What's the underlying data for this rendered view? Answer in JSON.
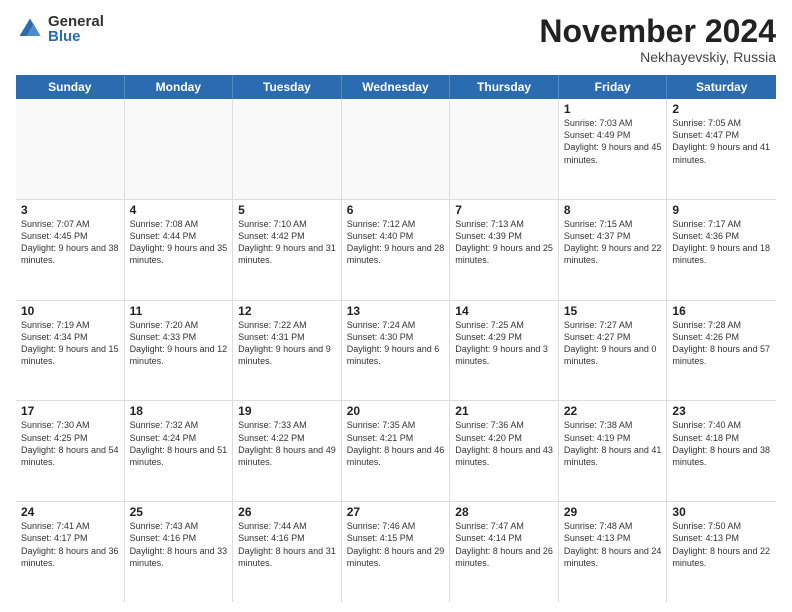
{
  "logo": {
    "general": "General",
    "blue": "Blue"
  },
  "title": "November 2024",
  "location": "Nekhayevskiy, Russia",
  "days": [
    "Sunday",
    "Monday",
    "Tuesday",
    "Wednesday",
    "Thursday",
    "Friday",
    "Saturday"
  ],
  "weeks": [
    [
      {
        "day": "",
        "text": "",
        "empty": true
      },
      {
        "day": "",
        "text": "",
        "empty": true
      },
      {
        "day": "",
        "text": "",
        "empty": true
      },
      {
        "day": "",
        "text": "",
        "empty": true
      },
      {
        "day": "",
        "text": "",
        "empty": true
      },
      {
        "day": "1",
        "text": "Sunrise: 7:03 AM\nSunset: 4:49 PM\nDaylight: 9 hours and 45 minutes.",
        "empty": false
      },
      {
        "day": "2",
        "text": "Sunrise: 7:05 AM\nSunset: 4:47 PM\nDaylight: 9 hours and 41 minutes.",
        "empty": false
      }
    ],
    [
      {
        "day": "3",
        "text": "Sunrise: 7:07 AM\nSunset: 4:45 PM\nDaylight: 9 hours and 38 minutes.",
        "empty": false
      },
      {
        "day": "4",
        "text": "Sunrise: 7:08 AM\nSunset: 4:44 PM\nDaylight: 9 hours and 35 minutes.",
        "empty": false
      },
      {
        "day": "5",
        "text": "Sunrise: 7:10 AM\nSunset: 4:42 PM\nDaylight: 9 hours and 31 minutes.",
        "empty": false
      },
      {
        "day": "6",
        "text": "Sunrise: 7:12 AM\nSunset: 4:40 PM\nDaylight: 9 hours and 28 minutes.",
        "empty": false
      },
      {
        "day": "7",
        "text": "Sunrise: 7:13 AM\nSunset: 4:39 PM\nDaylight: 9 hours and 25 minutes.",
        "empty": false
      },
      {
        "day": "8",
        "text": "Sunrise: 7:15 AM\nSunset: 4:37 PM\nDaylight: 9 hours and 22 minutes.",
        "empty": false
      },
      {
        "day": "9",
        "text": "Sunrise: 7:17 AM\nSunset: 4:36 PM\nDaylight: 9 hours and 18 minutes.",
        "empty": false
      }
    ],
    [
      {
        "day": "10",
        "text": "Sunrise: 7:19 AM\nSunset: 4:34 PM\nDaylight: 9 hours and 15 minutes.",
        "empty": false
      },
      {
        "day": "11",
        "text": "Sunrise: 7:20 AM\nSunset: 4:33 PM\nDaylight: 9 hours and 12 minutes.",
        "empty": false
      },
      {
        "day": "12",
        "text": "Sunrise: 7:22 AM\nSunset: 4:31 PM\nDaylight: 9 hours and 9 minutes.",
        "empty": false
      },
      {
        "day": "13",
        "text": "Sunrise: 7:24 AM\nSunset: 4:30 PM\nDaylight: 9 hours and 6 minutes.",
        "empty": false
      },
      {
        "day": "14",
        "text": "Sunrise: 7:25 AM\nSunset: 4:29 PM\nDaylight: 9 hours and 3 minutes.",
        "empty": false
      },
      {
        "day": "15",
        "text": "Sunrise: 7:27 AM\nSunset: 4:27 PM\nDaylight: 9 hours and 0 minutes.",
        "empty": false
      },
      {
        "day": "16",
        "text": "Sunrise: 7:28 AM\nSunset: 4:26 PM\nDaylight: 8 hours and 57 minutes.",
        "empty": false
      }
    ],
    [
      {
        "day": "17",
        "text": "Sunrise: 7:30 AM\nSunset: 4:25 PM\nDaylight: 8 hours and 54 minutes.",
        "empty": false
      },
      {
        "day": "18",
        "text": "Sunrise: 7:32 AM\nSunset: 4:24 PM\nDaylight: 8 hours and 51 minutes.",
        "empty": false
      },
      {
        "day": "19",
        "text": "Sunrise: 7:33 AM\nSunset: 4:22 PM\nDaylight: 8 hours and 49 minutes.",
        "empty": false
      },
      {
        "day": "20",
        "text": "Sunrise: 7:35 AM\nSunset: 4:21 PM\nDaylight: 8 hours and 46 minutes.",
        "empty": false
      },
      {
        "day": "21",
        "text": "Sunrise: 7:36 AM\nSunset: 4:20 PM\nDaylight: 8 hours and 43 minutes.",
        "empty": false
      },
      {
        "day": "22",
        "text": "Sunrise: 7:38 AM\nSunset: 4:19 PM\nDaylight: 8 hours and 41 minutes.",
        "empty": false
      },
      {
        "day": "23",
        "text": "Sunrise: 7:40 AM\nSunset: 4:18 PM\nDaylight: 8 hours and 38 minutes.",
        "empty": false
      }
    ],
    [
      {
        "day": "24",
        "text": "Sunrise: 7:41 AM\nSunset: 4:17 PM\nDaylight: 8 hours and 36 minutes.",
        "empty": false
      },
      {
        "day": "25",
        "text": "Sunrise: 7:43 AM\nSunset: 4:16 PM\nDaylight: 8 hours and 33 minutes.",
        "empty": false
      },
      {
        "day": "26",
        "text": "Sunrise: 7:44 AM\nSunset: 4:16 PM\nDaylight: 8 hours and 31 minutes.",
        "empty": false
      },
      {
        "day": "27",
        "text": "Sunrise: 7:46 AM\nSunset: 4:15 PM\nDaylight: 8 hours and 29 minutes.",
        "empty": false
      },
      {
        "day": "28",
        "text": "Sunrise: 7:47 AM\nSunset: 4:14 PM\nDaylight: 8 hours and 26 minutes.",
        "empty": false
      },
      {
        "day": "29",
        "text": "Sunrise: 7:48 AM\nSunset: 4:13 PM\nDaylight: 8 hours and 24 minutes.",
        "empty": false
      },
      {
        "day": "30",
        "text": "Sunrise: 7:50 AM\nSunset: 4:13 PM\nDaylight: 8 hours and 22 minutes.",
        "empty": false
      }
    ]
  ]
}
